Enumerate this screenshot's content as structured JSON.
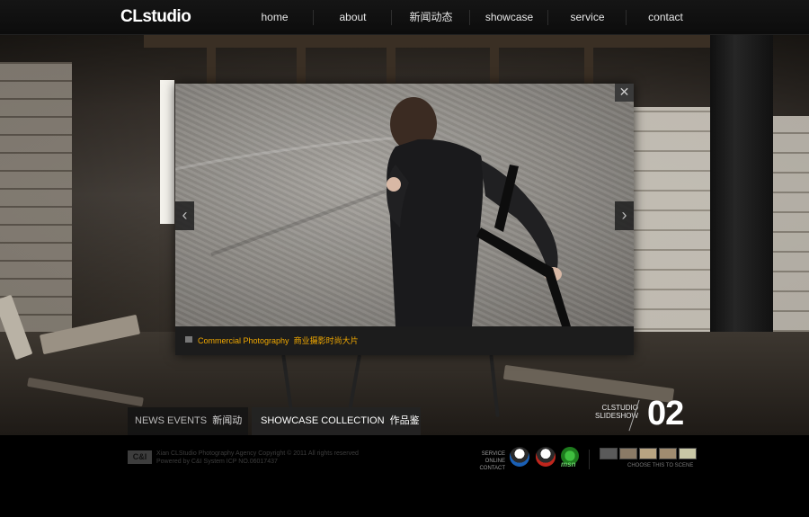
{
  "header": {
    "logo": "CLstudio",
    "nav": [
      "home",
      "about",
      "新闻动态",
      "showcase",
      "service",
      "contact"
    ]
  },
  "lightbox": {
    "caption_en": "Commercial Photography",
    "caption_cn": "商业摄影时尚大片",
    "close_glyph": "✕",
    "prev_glyph": "‹",
    "next_glyph": "›"
  },
  "tabs": [
    {
      "en": "NEWS EVENTS",
      "cn": "新闻动态"
    },
    {
      "en": "SHOWCASE COLLECTION",
      "cn": "作品鉴赏"
    }
  ],
  "slideshow": {
    "label_line1": "CLSTUDIO",
    "label_line2": "SLIDESHOW",
    "number": "02"
  },
  "footer": {
    "logo": "C&I",
    "copyright_line1": "Xian CLStudio Photography Agency Copyright © 2011 All rights reserved",
    "copyright_line2": "Powered by C&I System ICP NO.06017437",
    "service_line1": "SERVICE ONLINE",
    "service_line2": "CONTACT",
    "im_icons": [
      "qq-icon",
      "qq-icon",
      "msn-icon"
    ],
    "msn_label": "msn",
    "choose_label": "CHOOSE THIS TO SCENE",
    "thumb_colors": [
      "#5a5a5a",
      "#8a7a66",
      "#b8a482",
      "#a08c70",
      "#c9c7a6"
    ]
  },
  "colors": {
    "accent": "#f2a900",
    "background": "#000000"
  }
}
